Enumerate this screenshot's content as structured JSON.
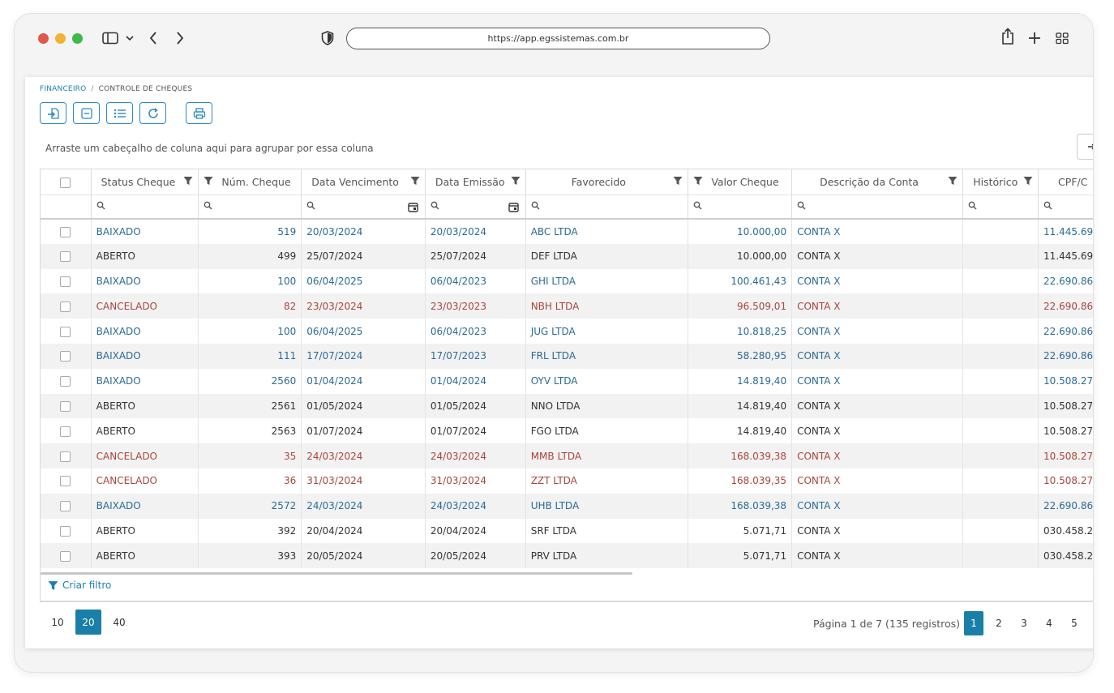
{
  "browser": {
    "url": "https://app.egssistemas.com.br"
  },
  "breadcrumb": {
    "parent": "FINANCEIRO",
    "separator": "/",
    "current": "CONTROLE DE CHEQUES"
  },
  "toolbar": {
    "buttons": [
      "import-icon",
      "collapse-icon",
      "list-icon",
      "refresh-icon",
      "print-icon"
    ]
  },
  "group_hint": "Arraste um cabeçalho de coluna aqui para agrupar por essa coluna",
  "columns": [
    "Status Cheque",
    "Núm. Cheque",
    "Data Vencimento",
    "Data Emissão",
    "Favorecido",
    "Valor Cheque",
    "Descrição da Conta",
    "Histórico",
    "CPF/C"
  ],
  "rows": [
    {
      "status": "BAIXADO",
      "num": "519",
      "venc": "20/03/2024",
      "emis": "20/03/2024",
      "fav": "ABC LTDA",
      "valor": "10.000,00",
      "conta": "CONTA X",
      "hist": "",
      "cpf": "11.445.69"
    },
    {
      "status": "ABERTO",
      "num": "499",
      "venc": "25/07/2024",
      "emis": "25/07/2024",
      "fav": "DEF LTDA",
      "valor": "10.000,00",
      "conta": "CONTA X",
      "hist": "",
      "cpf": "11.445.69"
    },
    {
      "status": "BAIXADO",
      "num": "100",
      "venc": "06/04/2025",
      "emis": "06/04/2023",
      "fav": "GHI LTDA",
      "valor": "100.461,43",
      "conta": "CONTA X",
      "hist": "",
      "cpf": "22.690.86"
    },
    {
      "status": "CANCELADO",
      "num": "82",
      "venc": "23/03/2024",
      "emis": "23/03/2023",
      "fav": "NBH LTDA",
      "valor": "96.509,01",
      "conta": "CONTA X",
      "hist": "",
      "cpf": "22.690.86"
    },
    {
      "status": "BAIXADO",
      "num": "100",
      "venc": "06/04/2025",
      "emis": "06/04/2023",
      "fav": "JUG LTDA",
      "valor": "10.818,25",
      "conta": "CONTA X",
      "hist": "",
      "cpf": "22.690.86"
    },
    {
      "status": "BAIXADO",
      "num": "111",
      "venc": "17/07/2024",
      "emis": "17/07/2023",
      "fav": "FRL LTDA",
      "valor": "58.280,95",
      "conta": "CONTA X",
      "hist": "",
      "cpf": "22.690.86"
    },
    {
      "status": "BAIXADO",
      "num": "2560",
      "venc": "01/04/2024",
      "emis": "01/04/2024",
      "fav": "OYV LTDA",
      "valor": "14.819,40",
      "conta": "CONTA X",
      "hist": "",
      "cpf": "10.508.27"
    },
    {
      "status": "ABERTO",
      "num": "2561",
      "venc": "01/05/2024",
      "emis": "01/05/2024",
      "fav": "NNO LTDA",
      "valor": "14.819,40",
      "conta": "CONTA X",
      "hist": "",
      "cpf": "10.508.27"
    },
    {
      "status": "ABERTO",
      "num": "2563",
      "venc": "01/07/2024",
      "emis": "01/07/2024",
      "fav": "FGO LTDA",
      "valor": "14.819,40",
      "conta": "CONTA X",
      "hist": "",
      "cpf": "10.508.27"
    },
    {
      "status": "CANCELADO",
      "num": "35",
      "venc": "24/03/2024",
      "emis": "24/03/2024",
      "fav": "MMB LTDA",
      "valor": "168.039,38",
      "conta": "CONTA X",
      "hist": "",
      "cpf": "10.508.27"
    },
    {
      "status": "CANCELADO",
      "num": "36",
      "venc": "31/03/2024",
      "emis": "31/03/2024",
      "fav": "ZZT LTDA",
      "valor": "168.039,35",
      "conta": "CONTA X",
      "hist": "",
      "cpf": "10.508.27"
    },
    {
      "status": "BAIXADO",
      "num": "2572",
      "venc": "24/03/2024",
      "emis": "24/03/2024",
      "fav": "UHB LTDA",
      "valor": "168.039,38",
      "conta": "CONTA X",
      "hist": "",
      "cpf": "22.690.86"
    },
    {
      "status": "ABERTO",
      "num": "392",
      "venc": "20/04/2024",
      "emis": "20/04/2024",
      "fav": "SRF LTDA",
      "valor": "5.071,71",
      "conta": "CONTA X",
      "hist": "",
      "cpf": "030.458.2"
    },
    {
      "status": "ABERTO",
      "num": "393",
      "venc": "20/05/2024",
      "emis": "20/05/2024",
      "fav": "PRV LTDA",
      "valor": "5.071,71",
      "conta": "CONTA X",
      "hist": "",
      "cpf": "030.458.2"
    }
  ],
  "filter_link": "Criar filtro",
  "page_sizes": [
    "10",
    "20",
    "40"
  ],
  "page_size_selected": "20",
  "page_info": "Página 1 de 7 (135 registros)",
  "pages": [
    "1",
    "2",
    "3",
    "4",
    "5"
  ],
  "current_page": "1",
  "colors": {
    "accent": "#1a7fa8",
    "baixado": "#2b6a96",
    "aberto": "#333333",
    "cancelado": "#a8453c"
  }
}
